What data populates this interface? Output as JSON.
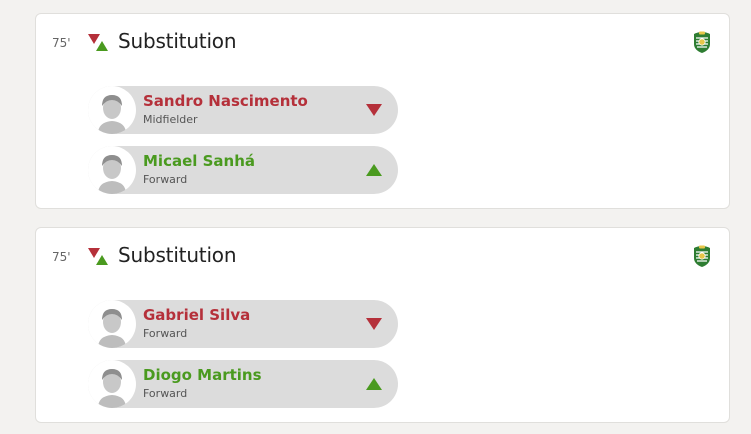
{
  "colors": {
    "out": "#b5303a",
    "in": "#4a9a1f",
    "badge_green": "#2e7d32"
  },
  "events": [
    {
      "minute": "75'",
      "title": "Substitution",
      "icon": "substitution-icon",
      "club_icon": "sporting-crest-icon",
      "player_out": {
        "name": "Sandro Nascimento",
        "position": "Midfielder",
        "icon": "arrow-down-icon"
      },
      "player_in": {
        "name": "Micael Sanhá",
        "position": "Forward",
        "icon": "arrow-up-icon"
      }
    },
    {
      "minute": "75'",
      "title": "Substitution",
      "icon": "substitution-icon",
      "club_icon": "sporting-crest-icon",
      "player_out": {
        "name": "Gabriel Silva",
        "position": "Forward",
        "icon": "arrow-down-icon"
      },
      "player_in": {
        "name": "Diogo Martins",
        "position": "Forward",
        "icon": "arrow-up-icon"
      }
    }
  ]
}
